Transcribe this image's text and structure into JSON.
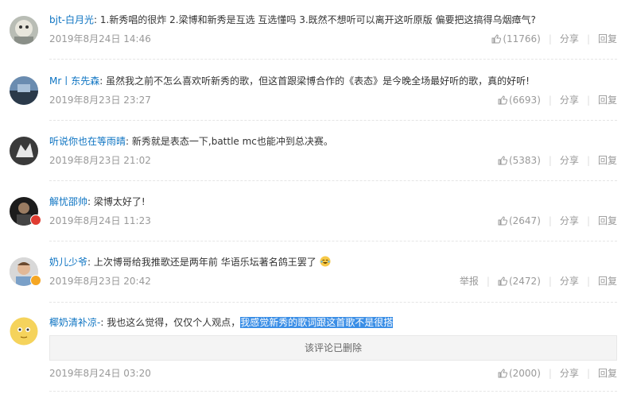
{
  "ops": {
    "report": "举报",
    "share": "分享",
    "reply": "回复",
    "bar": "|"
  },
  "comments": [
    {
      "user": "bjt-白月光",
      "sep": ":",
      "text": "1.新秀唱的很炸 2.梁博和新秀是互选 互选懂吗 3.既然不想听可以离开这听原版 偏要把这搞得乌烟瘴气?",
      "time": "2019年8月24日 14:46",
      "likes": "(11766)"
    },
    {
      "user": "Mr丨东先森",
      "sep": ":",
      "text": "虽然我之前不怎么喜欢听新秀的歌，但这首跟梁博合作的《表态》是今晚全场最好听的歌，真的好听!",
      "time": "2019年8月23日 23:27",
      "likes": "(6693)"
    },
    {
      "user": "听说你也在等雨晴",
      "sep": ":",
      "text": "新秀就是表态一下,battle mc也能冲到总决赛。",
      "time": "2019年8月23日 21:02",
      "likes": "(5383)"
    },
    {
      "user": "解忧邵帅",
      "sep": ":",
      "text": "梁博太好了!",
      "time": "2019年8月24日 11:23",
      "likes": "(2647)"
    },
    {
      "user": "奶儿少爷",
      "sep": ":",
      "text": "上次博哥给我推歌还是两年前 华语乐坛著名鸽王罢了",
      "time": "2019年8月23日 20:42",
      "likes": "(2472)",
      "report": true
    },
    {
      "user": "椰奶清补凉-",
      "sep": ":",
      "text": "我也这么觉得，仅仅个人观点，",
      "highlight": "我感觉新秀的歌词跟这首歌不是很搭",
      "deleted": "该评论已删除",
      "time": "2019年8月24日 03:20",
      "likes": "(2000)"
    }
  ],
  "colors": {
    "link": "#0c73c2",
    "meta": "#999999",
    "highlight": "#3a8ee6"
  }
}
